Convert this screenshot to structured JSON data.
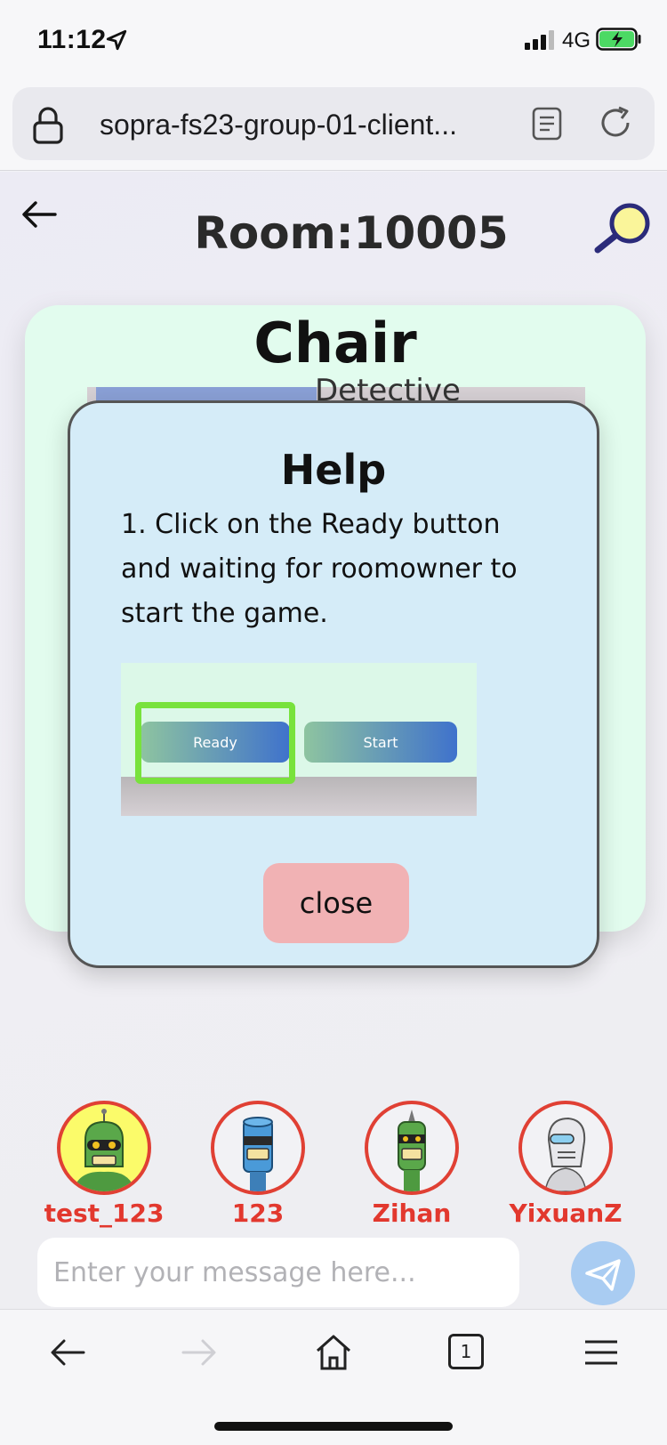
{
  "status_bar": {
    "time": "11:12",
    "network": "4G"
  },
  "browser": {
    "url": "sopra-fs23-group-01-client...",
    "tab_count": "1"
  },
  "header": {
    "room_title": "Room:10005"
  },
  "card": {
    "word": "Chair",
    "peek_text": "Detective"
  },
  "help_modal": {
    "title": "Help",
    "text": "1. Click on the Ready button and waiting for roomowner to start the game.",
    "preview": {
      "ready_label": "Ready",
      "start_label": "Start"
    },
    "close_label": "close"
  },
  "players": [
    {
      "name": "test_123",
      "active": true
    },
    {
      "name": "123",
      "active": false
    },
    {
      "name": "Zihan",
      "active": false
    },
    {
      "name": "YixuanZ",
      "active": false
    }
  ],
  "chat": {
    "placeholder": "Enter your message here..."
  },
  "colors": {
    "card_bg": "#e2fcee",
    "modal_bg": "#d5ecf8",
    "close_btn": "#f1b2b4",
    "player_name": "#e2382e",
    "send_btn": "#a9ccf2"
  }
}
